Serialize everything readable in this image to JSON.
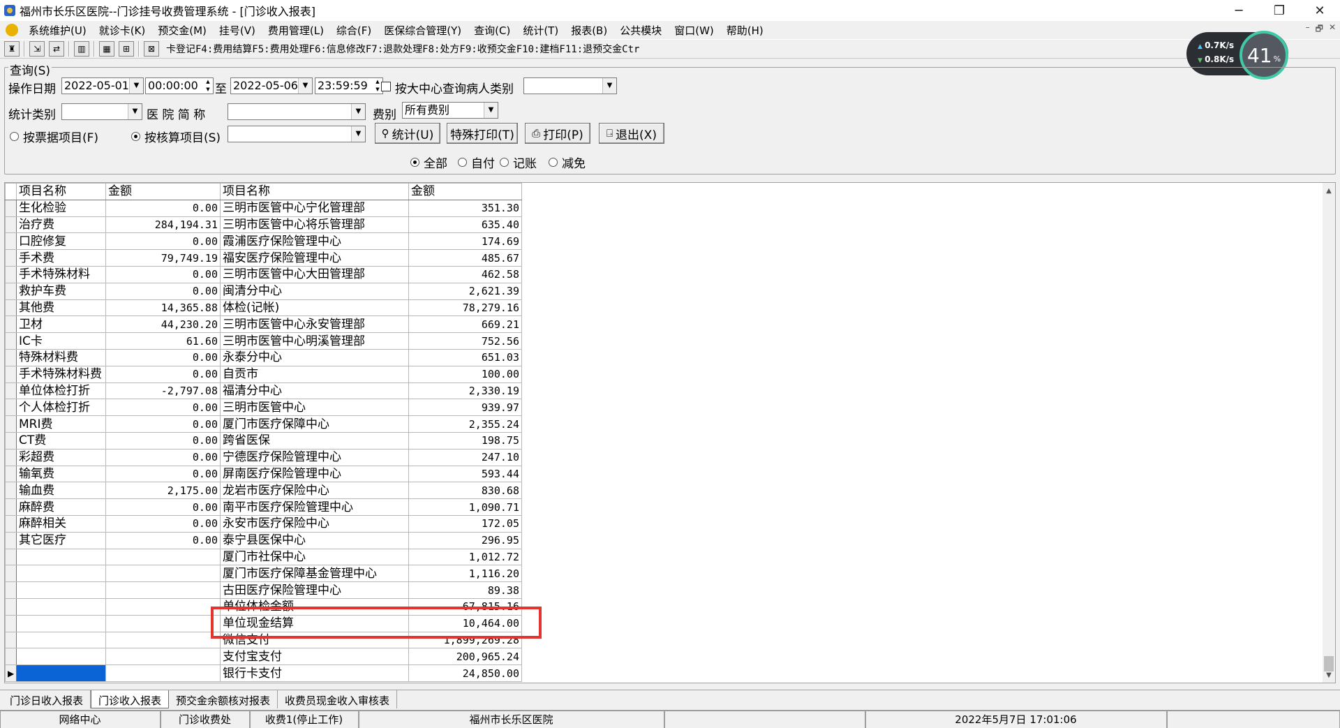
{
  "window": {
    "title": "福州市长乐区医院--门诊挂号收费管理系统 - [门诊收入报表]",
    "controls": [
      "─",
      "❐",
      "✕"
    ]
  },
  "menu": [
    "系统维护(U)",
    "就诊卡(K)",
    "预交金(M)",
    "挂号(V)",
    "费用管理(L)",
    "综合(F)",
    "医保综合管理(Y)",
    "查询(C)",
    "统计(T)",
    "报表(B)",
    "公共模块",
    "窗口(W)",
    "帮助(H)"
  ],
  "mdi_controls": [
    "–",
    "🗗",
    "✕"
  ],
  "toolbar": {
    "shortcuts": "卡登记F4:费用结算F5:费用处理F6:信息修改F7:退款处理F8:处方F9:收预交金F10:建档F11:退预交金Ctr"
  },
  "net_widget": {
    "up": "0.7K/s",
    "down": "0.8K/s",
    "percent": "41",
    "unit": "%"
  },
  "query": {
    "legend": "查询(S)",
    "date_label": "操作日期",
    "date_from": "2022-05-01",
    "time_from": "00:00:00",
    "to_label": "至",
    "date_to": "2022-05-06",
    "time_to": "23:59:59",
    "center_query_label": "按大中心查询病人类别",
    "center_query_value": "",
    "stat_type_label": "统计类别",
    "stat_type_value": "",
    "hospital_label": "医 院 简 称",
    "hospital_value": "",
    "fee_label": "费别",
    "fee_value": "所有费别",
    "by_invoice_label": "按票据项目(F)",
    "by_accounting_label": "按核算项目(S)",
    "accounting_value": "",
    "btn_stat": "统计(U)",
    "btn_special_print": "特殊打印(T)",
    "btn_print": "打印(P)",
    "btn_exit": "退出(X)",
    "pay_filter": [
      "全部",
      "自付",
      "记账",
      "减免"
    ]
  },
  "grid": {
    "headers": [
      "项目名称",
      "金额",
      "项目名称",
      "金额"
    ],
    "rows": [
      [
        "生化检验",
        "0.00",
        "三明市医管中心宁化管理部",
        "351.30"
      ],
      [
        "治疗费",
        "284,194.31",
        "三明市医管中心将乐管理部",
        "635.40"
      ],
      [
        "口腔修复",
        "0.00",
        "霞浦医疗保险管理中心",
        "174.69"
      ],
      [
        "手术费",
        "79,749.19",
        "福安医疗保险管理中心",
        "485.67"
      ],
      [
        "手术特殊材料",
        "0.00",
        "三明市医管中心大田管理部",
        "462.58"
      ],
      [
        "救护车费",
        "0.00",
        "闽清分中心",
        "2,621.39"
      ],
      [
        "其他费",
        "14,365.88",
        "体检(记帐)",
        "78,279.16"
      ],
      [
        "卫材",
        "44,230.20",
        "三明市医管中心永安管理部",
        "669.21"
      ],
      [
        "IC卡",
        "61.60",
        "三明市医管中心明溪管理部",
        "752.56"
      ],
      [
        "特殊材料费",
        "0.00",
        "永泰分中心",
        "651.03"
      ],
      [
        "手术特殊材料费",
        "0.00",
        "自贡市",
        "100.00"
      ],
      [
        "单位体检打折",
        "-2,797.08",
        "福清分中心",
        "2,330.19"
      ],
      [
        "个人体检打折",
        "0.00",
        "三明市医管中心",
        "939.97"
      ],
      [
        "MRI费",
        "0.00",
        "厦门市医疗保障中心",
        "2,355.24"
      ],
      [
        "CT费",
        "0.00",
        "跨省医保",
        "198.75"
      ],
      [
        "彩超费",
        "0.00",
        "宁德医疗保险管理中心",
        "247.10"
      ],
      [
        "输氧费",
        "0.00",
        "屏南医疗保险管理中心",
        "593.44"
      ],
      [
        "输血费",
        "2,175.00",
        "龙岩市医疗保险中心",
        "830.68"
      ],
      [
        "麻醉费",
        "0.00",
        "南平市医疗保险管理中心",
        "1,090.71"
      ],
      [
        "麻醉相关",
        "0.00",
        "永安市医疗保险中心",
        "172.05"
      ],
      [
        "其它医疗",
        "0.00",
        "泰宁县医保中心",
        "296.95"
      ],
      [
        "",
        "",
        "厦门市社保中心",
        "1,012.72"
      ],
      [
        "",
        "",
        "厦门市医疗保障基金管理中心",
        "1,116.20"
      ],
      [
        "",
        "",
        "古田医疗保险管理中心",
        "89.38"
      ],
      [
        "",
        "",
        "单位体检金额",
        "67,815.16"
      ],
      [
        "",
        "",
        "单位现金结算",
        "10,464.00"
      ],
      [
        "",
        "",
        "微信支付",
        "1,899,269.28"
      ],
      [
        "",
        "",
        "支付宝支付",
        "200,965.24"
      ],
      [
        "",
        "",
        "银行卡支付",
        "24,850.00"
      ]
    ]
  },
  "tabs": [
    "门诊日收入报表",
    "门诊收入报表",
    "预交金余额核对报表",
    "收费员现金收入审核表"
  ],
  "status": [
    "网络中心",
    "门诊收费处",
    "收费1(停止工作)",
    "福州市长乐区医院",
    "",
    "2022年5月7日 17:01:06",
    ""
  ],
  "colors": {
    "highlight": "#e3342f",
    "selection": "#0a64d6"
  }
}
